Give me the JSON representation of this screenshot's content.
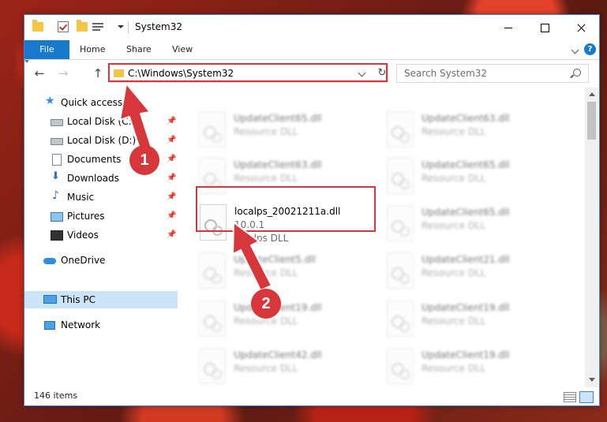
{
  "window": {
    "title": "System32",
    "controls": {
      "minimize": "minimize",
      "maximize": "maximize",
      "close": "close"
    }
  },
  "ribbon": {
    "file_tab": "File",
    "tabs": [
      "Home",
      "Share",
      "View"
    ]
  },
  "address_bar": {
    "path": "C:\\Windows\\System32",
    "search_placeholder": "Search System32"
  },
  "nav_pane": {
    "items": [
      {
        "label": "Quick access",
        "icon": "star-icon",
        "pinned": false
      },
      {
        "label": "Local Disk (C:)",
        "icon": "disk-icon",
        "pinned": true
      },
      {
        "label": "Local Disk (D:)",
        "icon": "disk-icon",
        "pinned": true
      },
      {
        "label": "Documents",
        "icon": "document-icon",
        "pinned": true
      },
      {
        "label": "Downloads",
        "icon": "download-icon",
        "pinned": true
      },
      {
        "label": "Music",
        "icon": "music-icon",
        "pinned": true
      },
      {
        "label": "Pictures",
        "icon": "pictures-icon",
        "pinned": true
      },
      {
        "label": "Videos",
        "icon": "videos-icon",
        "pinned": true
      },
      {
        "label": "OneDrive",
        "icon": "cloud-icon",
        "pinned": false
      },
      {
        "label": "This PC",
        "icon": "computer-icon",
        "pinned": false,
        "selected": true
      },
      {
        "label": "Network",
        "icon": "network-icon",
        "pinned": false
      }
    ]
  },
  "files": {
    "highlighted": {
      "name": "localps_20021211a.dll",
      "version": "10.0.1",
      "type": "localps DLL"
    },
    "background_left": [
      {
        "name": "UpdateClient65.dll",
        "type": "Resource DLL"
      },
      {
        "name": "UpdateClient63.dll",
        "type": "Resource DLL"
      },
      {
        "name": "UpdateClient5.dll",
        "type": "Resource DLL"
      },
      {
        "name": "UpdateClient19.dll",
        "type": "Resource DLL"
      },
      {
        "name": "UpdateClient42.dll",
        "type": "Resource DLL"
      }
    ],
    "background_right": [
      {
        "name": "UpdateClient63.dll",
        "type": "Resource DLL"
      },
      {
        "name": "UpdateClient65.dll",
        "type": "Resource DLL"
      },
      {
        "name": "UpdateClient65.dll",
        "type": "Resource DLL"
      },
      {
        "name": "UpdateClient21.dll",
        "type": "Resource DLL"
      },
      {
        "name": "UpdateClient19.dll",
        "type": "Resource DLL"
      },
      {
        "name": "UpdateClient19.dll",
        "type": "Resource DLL"
      }
    ]
  },
  "status_bar": {
    "item_count": "146 items"
  },
  "annotations": {
    "step1": "1",
    "step2": "2",
    "highlight_color": "#d7373a"
  }
}
